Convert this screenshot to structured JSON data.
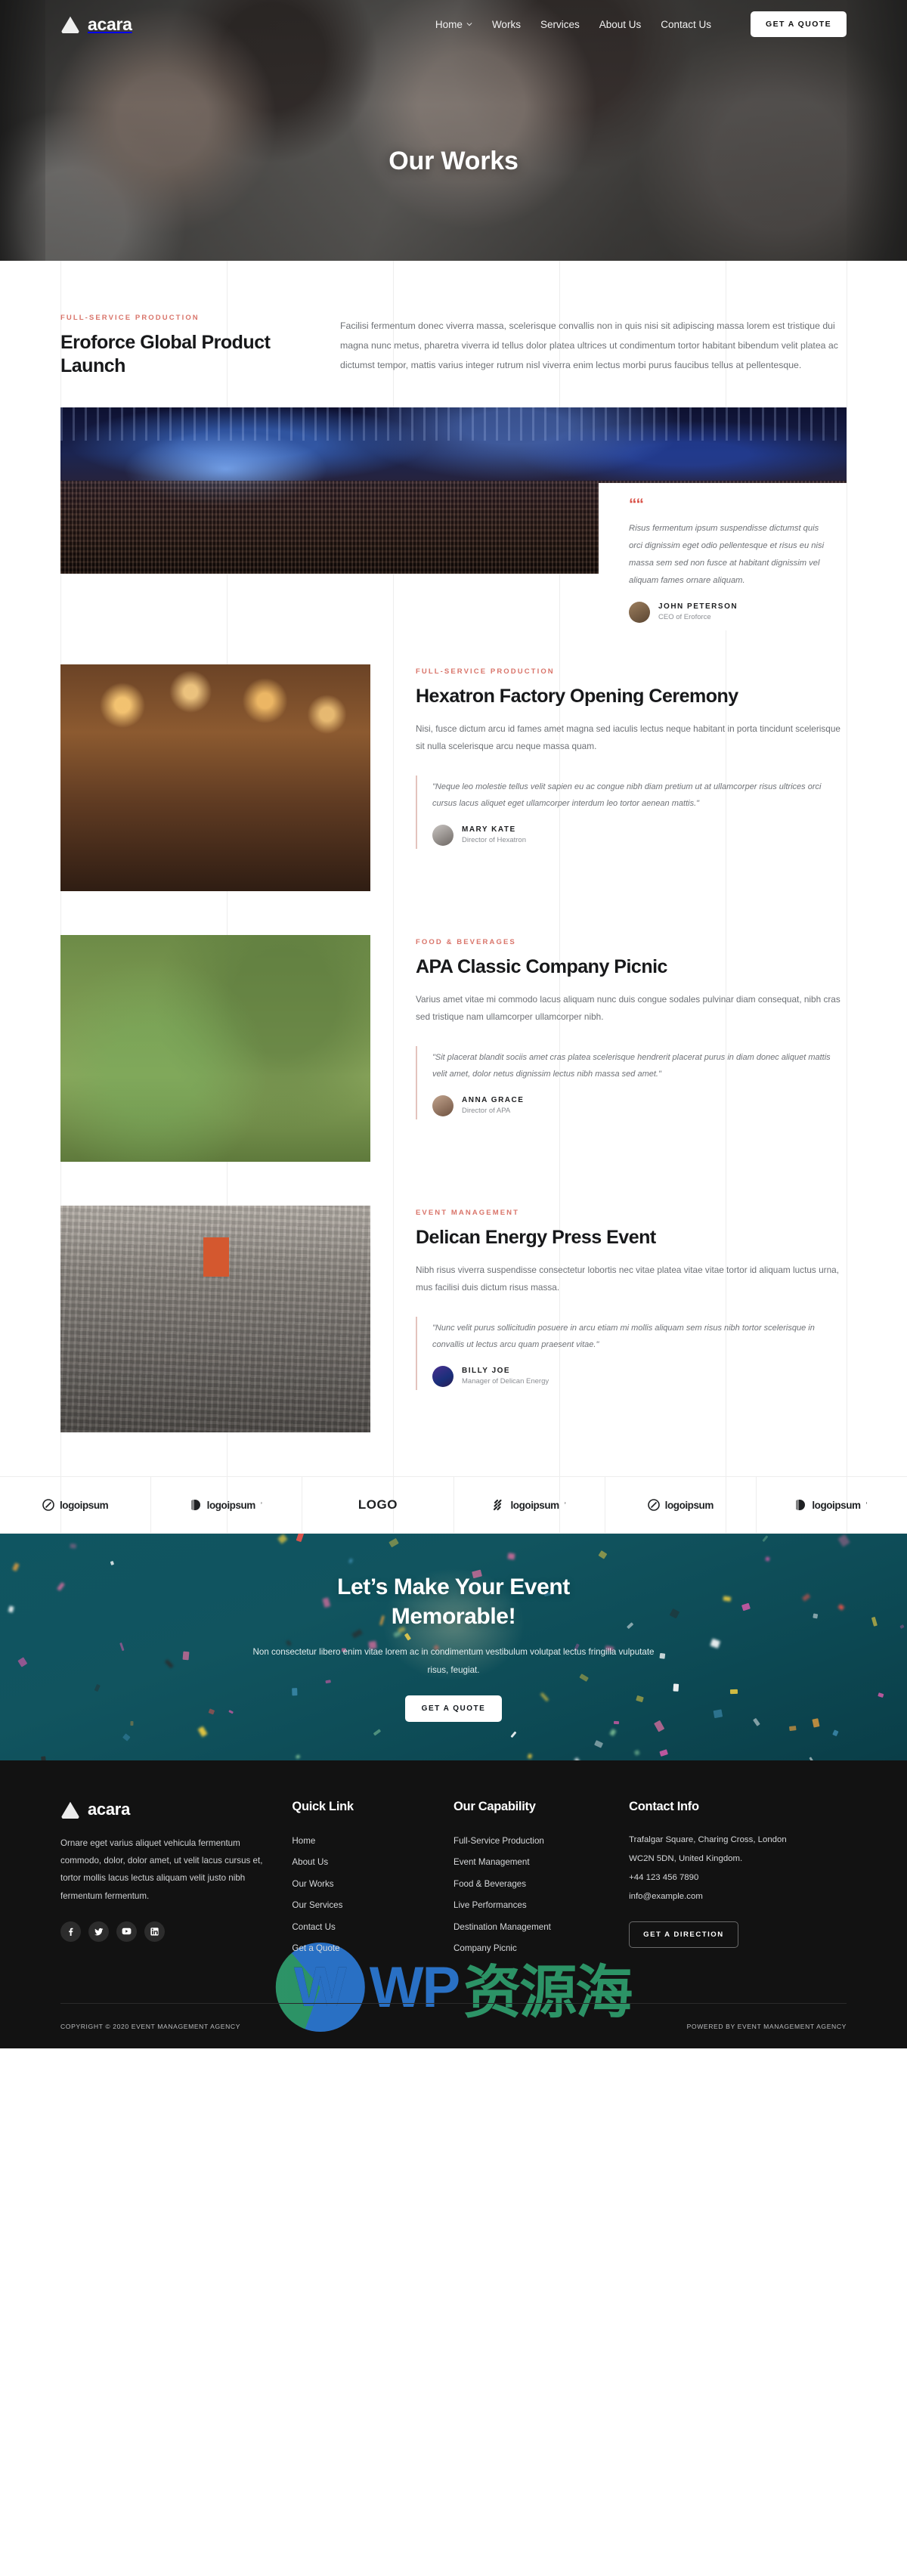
{
  "brand": {
    "name": "acara",
    "logo_icon": "triangle-logo-icon"
  },
  "nav": {
    "links": [
      {
        "label": "Home",
        "has_dropdown": true
      },
      {
        "label": "Works",
        "has_dropdown": false
      },
      {
        "label": "Services",
        "has_dropdown": false
      },
      {
        "label": "About Us",
        "has_dropdown": false
      },
      {
        "label": "Contact Us",
        "has_dropdown": false
      }
    ],
    "cta_label": "GET A QUOTE"
  },
  "hero": {
    "title": "Our Works"
  },
  "works": [
    {
      "eyebrow": "FULL-SERVICE PRODUCTION",
      "title": "Eroforce Global Product Launch",
      "body": "Facilisi fermentum donec viverra massa, scelerisque convallis non in quis nisi sit adipiscing massa lorem est tristique dui magna nunc metus, pharetra viverra id tellus dolor platea ultrices ut condimentum tortor habitant bibendum velit platea ac dictumst tempor, mattis varius integer rutrum nisl viverra enim lectus morbi purus faucibus tellus at pellentesque.",
      "quote": "Risus fermentum ipsum suspendisse dictumst quis orci dignissim eget odio pellentesque et risus eu nisi massa sem sed non fusce at habitant dignissim vel aliquam fames ornare aliquam.",
      "author_name": "JOHN PETERSON",
      "author_role": "CEO of Eroforce"
    },
    {
      "eyebrow": "FULL-SERVICE PRODUCTION",
      "title": "Hexatron Factory Opening Ceremony",
      "body": "Nisi, fusce dictum arcu id fames amet magna sed iaculis lectus neque habitant in porta tincidunt scelerisque sit nulla scelerisque arcu neque massa quam.",
      "quote": "\"Neque leo molestie tellus velit sapien eu ac congue nibh diam pretium ut at ullamcorper risus ultrices orci cursus lacus aliquet eget ullamcorper interdum leo tortor aenean mattis.\"",
      "author_name": "MARY KATE",
      "author_role": "Director of Hexatron"
    },
    {
      "eyebrow": "FOOD & BEVERAGES",
      "title": "APA Classic Company Picnic",
      "body": "Varius amet vitae mi commodo lacus aliquam nunc duis congue sodales pulvinar diam consequat, nibh cras sed tristique nam ullamcorper ullamcorper nibh.",
      "quote": "\"Sit placerat blandit sociis amet cras platea scelerisque hendrerit placerat purus in diam donec aliquet mattis velit amet, dolor netus dignissim lectus nibh massa sed amet.\"",
      "author_name": "ANNA GRACE",
      "author_role": "Director of APA"
    },
    {
      "eyebrow": "EVENT MANAGEMENT",
      "title": "Delican Energy Press Event",
      "body": "Nibh risus viverra suspendisse consectetur lobortis nec vitae platea vitae vitae tortor id aliquam luctus urna, mus facilisi duis dictum risus massa.",
      "quote": "\"Nunc velit purus sollicitudin posuere in arcu etiam mi mollis aliquam sem risus nibh tortor scelerisque in convallis ut lectus arcu quam praesent vitae.\"",
      "author_name": "BILLY JOE",
      "author_role": "Manager of Delican Energy"
    }
  ],
  "logos": [
    {
      "text": "logoipsum",
      "sup": "",
      "style": "swirl"
    },
    {
      "text": "logoipsum",
      "sup": "’",
      "style": "half"
    },
    {
      "text": "LOGO",
      "sup": "",
      "style": "mono"
    },
    {
      "text": "logoipsum",
      "sup": "’",
      "style": "dashes"
    },
    {
      "text": "logoipsum",
      "sup": "",
      "style": "swirl"
    },
    {
      "text": "logoipsum",
      "sup": "’",
      "style": "half"
    }
  ],
  "cta": {
    "title_line1": "Let’s Make Your Event",
    "title_line2": "Memorable!",
    "body": "Non consectetur libero enim vitae lorem ac in condimentum vestibulum volutpat lectus fringilla vulputate risus, feugiat.",
    "button": "GET A QUOTE"
  },
  "footer": {
    "about": "Ornare eget varius aliquet vehicula fermentum commodo, dolor, dolor amet, ut velit lacus cursus et, tortor mollis lacus lectus aliquam velit justo nibh fermentum fermentum.",
    "socials": [
      "facebook-icon",
      "twitter-icon",
      "youtube-icon",
      "linkedin-icon"
    ],
    "quick_link": {
      "title": "Quick Link",
      "items": [
        "Home",
        "About Us",
        "Our Works",
        "Our Services",
        "Contact Us",
        "Get a Quote"
      ]
    },
    "capability": {
      "title": "Our Capability",
      "items": [
        "Full-Service Production",
        "Event Management",
        "Food & Beverages",
        "Live Performances",
        "Destination Management",
        "Company Picnic"
      ]
    },
    "contact": {
      "title": "Contact Info",
      "address_line1": "Trafalgar Square, Charing Cross, London",
      "address_line2": "WC2N 5DN, United Kingdom.",
      "phone": "+44 123 456 7890",
      "email": "info@example.com",
      "button": "GET A DIRECTION"
    },
    "copyright": "COPYRIGHT © 2020 EVENT MANAGEMENT AGENCY",
    "powered": "POWERED BY EVENT MANAGEMENT AGENCY"
  },
  "watermark": {
    "w_text": "WP",
    "cjk_text": "资源海"
  },
  "colors": {
    "accent": "#d9746a",
    "cta_bg": "#0f5561",
    "footer_bg": "#121212"
  }
}
